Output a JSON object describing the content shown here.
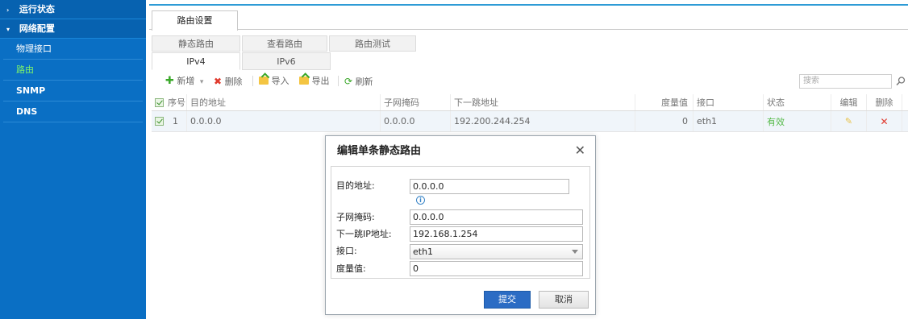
{
  "sidebar": {
    "groups": [
      {
        "label": "运行状态",
        "arrow": "›"
      },
      {
        "label": "网络配置",
        "arrow": "▾"
      }
    ],
    "items": [
      {
        "label": "物理接口"
      },
      {
        "label": "路由"
      },
      {
        "label": "SNMP"
      },
      {
        "label": "DNS"
      }
    ]
  },
  "top_tab": "路由设置",
  "sub_tabs": [
    "静态路由",
    "查看路由",
    "路由测试"
  ],
  "ip_tabs": [
    "IPv4",
    "IPv6"
  ],
  "toolbar": {
    "add": "新增",
    "add_caret": "▾",
    "delete": "删除",
    "import": "导入",
    "export": "导出",
    "refresh": "刷新",
    "search_placeholder": "搜索"
  },
  "table": {
    "headers": {
      "index": "序号",
      "dest": "目的地址",
      "mask": "子网掩码",
      "nexthop": "下一跳地址",
      "metric": "度量值",
      "iface": "接口",
      "status": "状态",
      "edit": "编辑",
      "delete": "删除"
    },
    "rows": [
      {
        "index": "1",
        "dest": "0.0.0.0",
        "mask": "0.0.0.0",
        "nexthop": "192.200.244.254",
        "metric": "0",
        "iface": "eth1",
        "status": "有效",
        "edit_icon": "✎",
        "delete_icon": "✕"
      }
    ]
  },
  "modal": {
    "title": "编辑单条静态路由",
    "close": "✕",
    "fields": {
      "dest_label": "目的地址:",
      "dest_value": "0.0.0.0",
      "mask_label": "子网掩码:",
      "mask_value": "0.0.0.0",
      "nexthop_label": "下一跳IP地址:",
      "nexthop_value": "192.168.1.254",
      "iface_label": "接口:",
      "iface_value": "eth1",
      "metric_label": "度量值:",
      "metric_value": "0"
    },
    "info_icon": "i",
    "submit": "提交",
    "cancel": "取消"
  },
  "icons": {
    "add": "✚",
    "delete": "✖",
    "refresh": "⟳"
  },
  "colors": {
    "sidebar": "#0a6fc4",
    "active_item": "#7cf26a",
    "accent": "#2e9bd6",
    "submit": "#2b6cc4",
    "valid": "#54b948",
    "danger": "#e03a2e"
  }
}
